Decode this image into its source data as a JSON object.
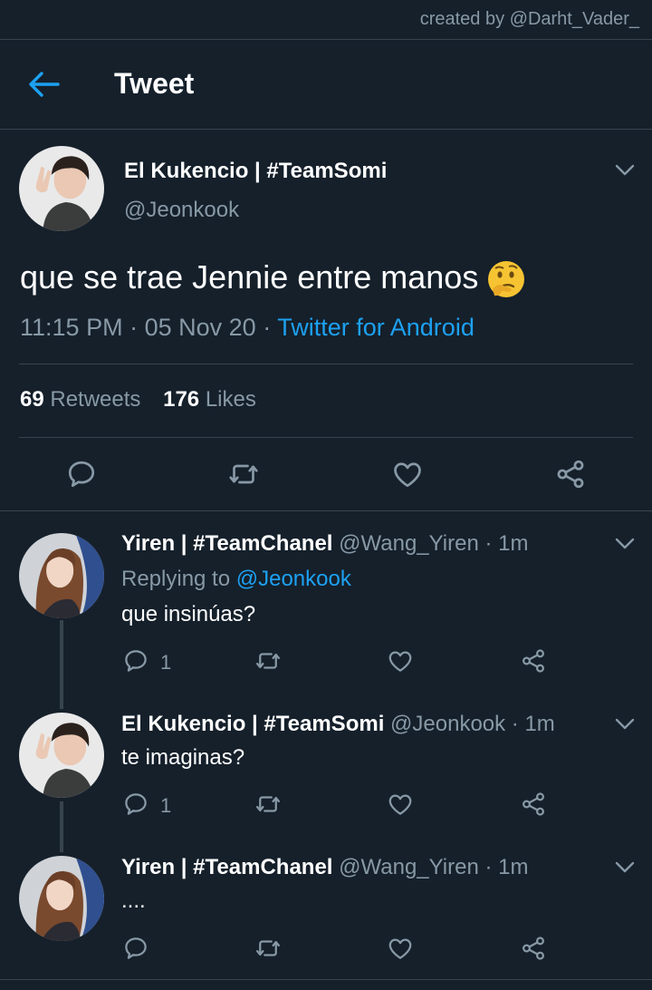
{
  "credit": "created by @Darht_Vader_",
  "header": {
    "title": "Tweet"
  },
  "main_tweet": {
    "name": "El Kukencio | #TeamSomi",
    "handle": "@Jeonkook",
    "text": "que se trae Jennie entre manos",
    "emoji": "thinking-face-emoji",
    "time": "11:15 PM",
    "date": "05 Nov 20",
    "source": "Twitter for Android",
    "retweets_count": "69",
    "retweets_label": "Retweets",
    "likes_count": "176",
    "likes_label": "Likes"
  },
  "replies": [
    {
      "name": "Yiren | #TeamChanel",
      "meta": "@Wang_Yiren · 1m",
      "replying_prefix": "Replying to",
      "replying_to": "@Jeonkook",
      "text": "que insinúas?",
      "reply_count": "1"
    },
    {
      "name": "El Kukencio | #TeamSomi",
      "meta": "@Jeonkook · 1m",
      "text": "te imaginas?",
      "reply_count": "1"
    },
    {
      "name": "Yiren | #TeamChanel",
      "meta": "@Wang_Yiren · 1m",
      "text": "....",
      "reply_count": ""
    }
  ],
  "colors": {
    "background": "#15202b",
    "accent": "#1da1f2",
    "muted": "#8899a6",
    "border": "#38444d"
  }
}
